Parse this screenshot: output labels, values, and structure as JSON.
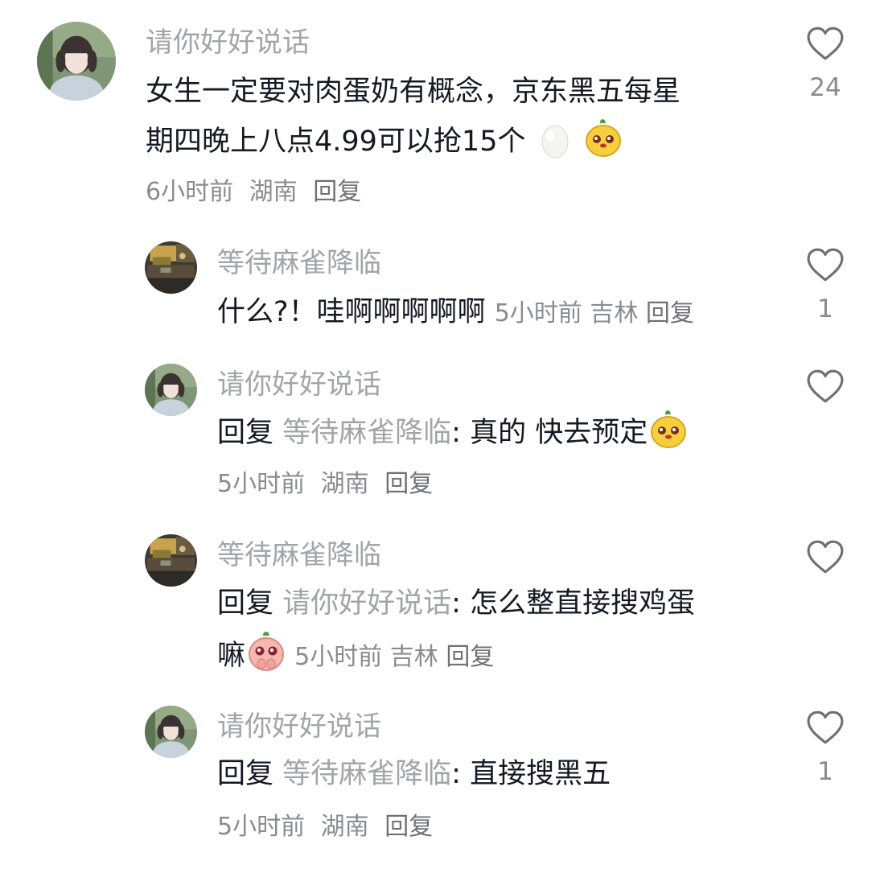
{
  "comments": [
    {
      "username": "请你好好说话",
      "text_line1": "女生一定要对肉蛋奶有概念，京东黑五每星",
      "text_line2": "期四晚上八点4.99可以抢15个",
      "emoji_1": "egg-emoji",
      "emoji_2": "yellow-face-sticker",
      "time": "6小时前",
      "location": "湖南",
      "reply_label": "回复",
      "likes": "24"
    },
    {
      "username": "等待麻雀降临",
      "text": "什么?！哇啊啊啊啊啊",
      "time": "5小时前",
      "location": "吉林",
      "reply_label": "回复",
      "likes": "1"
    },
    {
      "username": "请你好好说话",
      "reply_prefix": "回复",
      "reply_target": "等待麻雀降临",
      "separator": ":",
      "text": " 真的 快去预定",
      "emoji": "yellow-face-sticker",
      "time": "5小时前",
      "location": "湖南",
      "reply_label": "回复",
      "likes": ""
    },
    {
      "username": "等待麻雀降临",
      "reply_prefix": "回复",
      "reply_target": "请你好好说话",
      "separator": ":",
      "text_line1": " 怎么整直接搜鸡蛋",
      "text_line2": "嘛",
      "emoji": "pink-pleading-sticker",
      "time": "5小时前",
      "location": "吉林",
      "reply_label": "回复",
      "likes": ""
    },
    {
      "username": "请你好好说话",
      "reply_prefix": "回复",
      "reply_target": "等待麻雀降临",
      "separator": ":",
      "text": " 直接搜黑五",
      "time": "5小时前",
      "location": "湖南",
      "reply_label": "回复",
      "likes": "1"
    }
  ],
  "colors": {
    "username": "#a3a4a9",
    "text": "#161823",
    "meta": "#8a8b91",
    "heart": "#6f7076"
  }
}
